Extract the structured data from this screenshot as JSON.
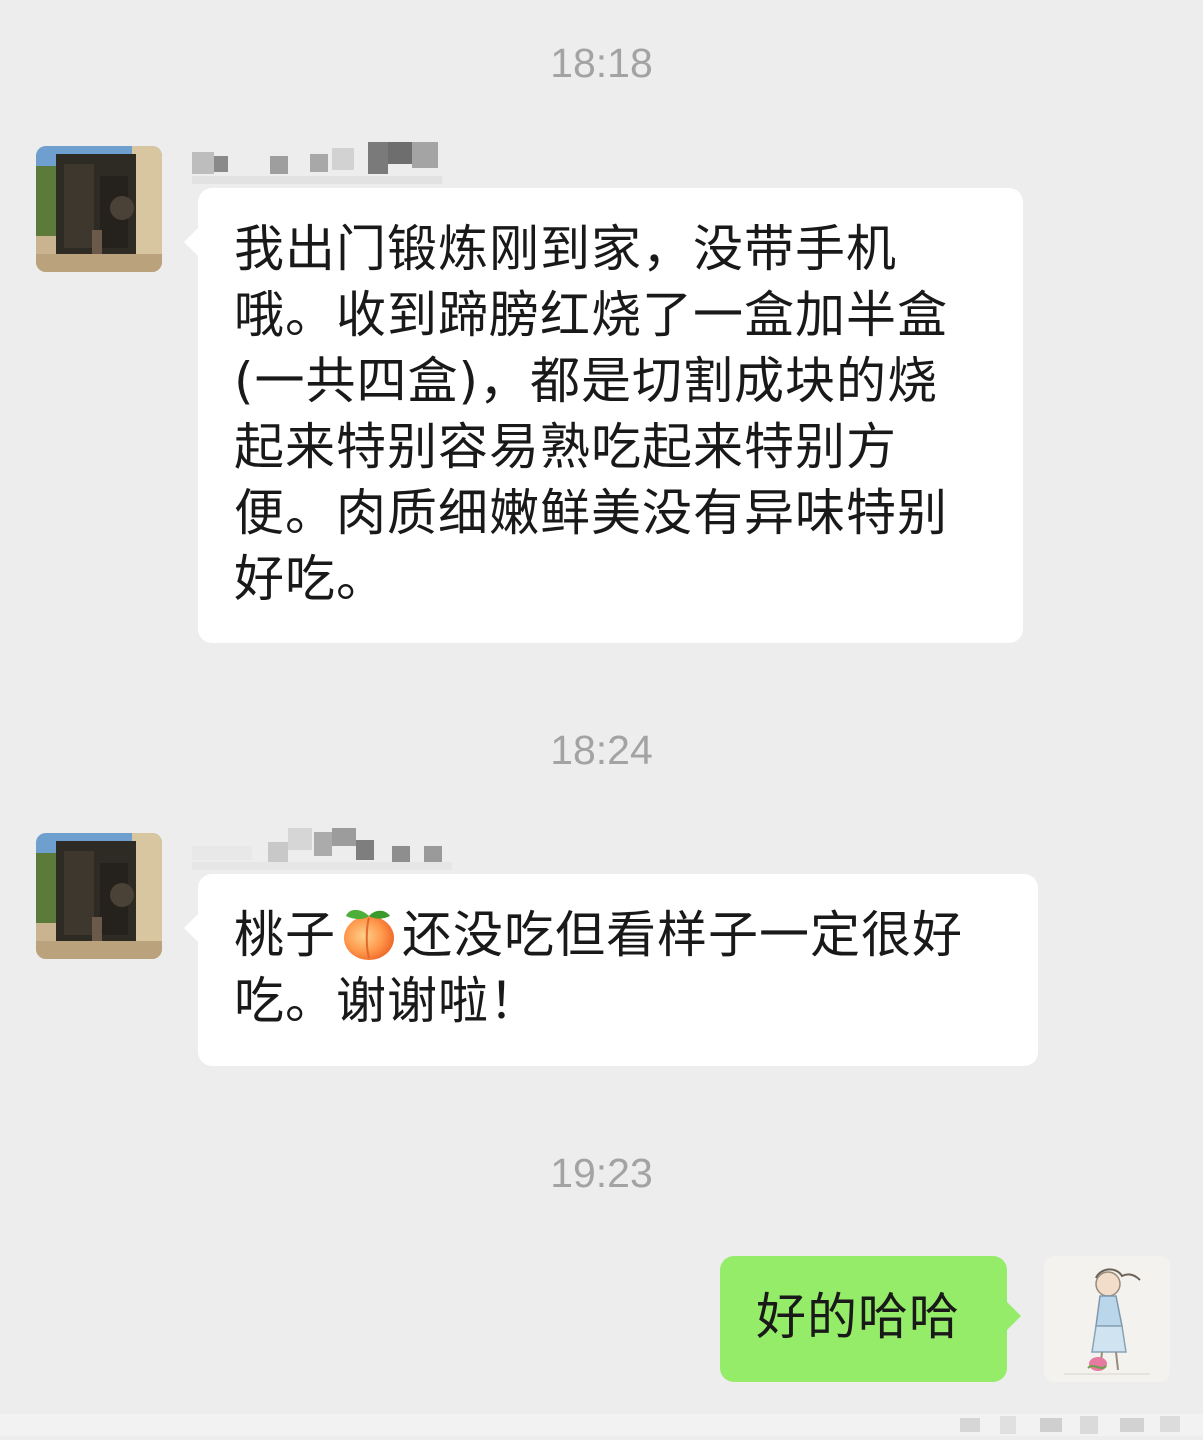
{
  "chat": {
    "messages": [
      {
        "timestamp": "18:18",
        "direction": "incoming",
        "text_lines": [
          "我出门锻炼刚到家，没带手机",
          "哦。收到蹄膀红烧了一盒加半盒",
          "(一共四盒)，都是切割成块的烧",
          "起来特别容易熟吃起来特别方",
          "便。肉质细嫩鲜美没有异味特别",
          "好吃。"
        ]
      },
      {
        "timestamp": "18:24",
        "direction": "incoming",
        "line1_before_emoji": "桃子",
        "emoji_icon": "peach-emoji-icon",
        "line1_after_emoji": "还没吃但看样子一定很好",
        "line2": "吃。谢谢啦！"
      },
      {
        "timestamp": "19:23",
        "direction": "outgoing",
        "text": "好的哈哈"
      }
    ]
  },
  "colors": {
    "background": "#ededed",
    "incoming_bubble": "#ffffff",
    "outgoing_bubble": "#95ec69",
    "timestamp": "#a3a3a3",
    "message_text": "#191919"
  }
}
